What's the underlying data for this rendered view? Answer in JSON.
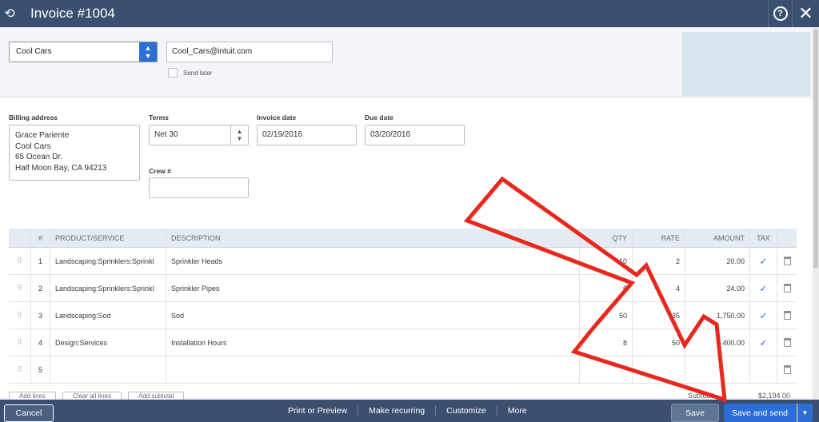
{
  "topbar": {
    "title": "Invoice #1004",
    "help_glyph": "?",
    "close_glyph": "✕",
    "history_glyph": "⟲"
  },
  "customer": {
    "name": "Cool Cars",
    "email": "Cool_Cars@intuit.com",
    "send_later_label": "Send later"
  },
  "billing": {
    "label": "Billing address",
    "lines": [
      "Grace Pariente",
      "Cool Cars",
      "65 Ocean Dr.",
      "Half Moon Bay, CA  94213"
    ]
  },
  "terms": {
    "label": "Terms",
    "value": "Net 30"
  },
  "invoice_date": {
    "label": "Invoice date",
    "value": "02/19/2016"
  },
  "due_date": {
    "label": "Due date",
    "value": "03/20/2016"
  },
  "crew": {
    "label": "Crew #",
    "value": ""
  },
  "table": {
    "headers": {
      "num": "#",
      "product": "PRODUCT/SERVICE",
      "description": "DESCRIPTION",
      "qty": "QTY",
      "rate": "RATE",
      "amount": "AMOUNT",
      "tax": "TAX"
    },
    "rows": [
      {
        "num": "1",
        "product": "Landscaping:Sprinklers:Sprinkl",
        "description": "Sprinkler Heads",
        "qty": "10",
        "rate": "2",
        "amount": "20.00",
        "tax": "✓"
      },
      {
        "num": "2",
        "product": "Landscaping:Sprinklers:Sprinkl",
        "description": "Sprinkler Pipes",
        "qty": "6",
        "rate": "4",
        "amount": "24.00",
        "tax": "✓"
      },
      {
        "num": "3",
        "product": "Landscaping:Sod",
        "description": "Sod",
        "qty": "50",
        "rate": "35",
        "amount": "1,750.00",
        "tax": "✓"
      },
      {
        "num": "4",
        "product": "Design:Services",
        "description": "Installation Hours",
        "qty": "8",
        "rate": "50",
        "amount": "400.00",
        "tax": "✓"
      },
      {
        "num": "5",
        "product": "",
        "description": "",
        "qty": "",
        "rate": "",
        "amount": "",
        "tax": ""
      }
    ]
  },
  "line_buttons": {
    "add_lines": "Add lines",
    "clear_all": "Clear all lines",
    "add_subtotal": "Add subtotal"
  },
  "subtotal": {
    "label": "Subtotal",
    "value": "$2,194.00"
  },
  "footer": {
    "cancel": "Cancel",
    "print_preview": "Print or Preview",
    "make_recurring": "Make recurring",
    "customize": "Customize",
    "more": "More",
    "save": "Save",
    "save_and_send": "Save and send"
  },
  "colors": {
    "header_bar": "#3b5070",
    "primary_button": "#2c6ed5",
    "annotation_arrow": "#e8271d"
  }
}
